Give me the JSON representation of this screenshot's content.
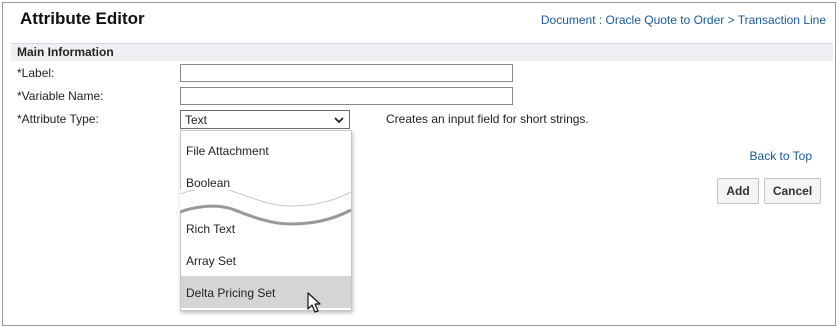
{
  "header": {
    "title": "Attribute Editor",
    "breadcrumb": "Document : Oracle Quote to Order > Transaction Line"
  },
  "section": {
    "title": "Main Information"
  },
  "form": {
    "label_field": {
      "label": "*Label:",
      "value": ""
    },
    "variable_name_field": {
      "label": "*Variable Name:",
      "value": ""
    },
    "attribute_type": {
      "label": "*Attribute Type:",
      "selected": "Text",
      "hint": "Creates an input field for short strings."
    }
  },
  "dropdown": {
    "options_top": [
      "File Attachment",
      "Boolean"
    ],
    "options_bottom": [
      "Rich Text",
      "Array Set",
      "Delta Pricing Set"
    ],
    "highlighted": "Delta Pricing Set"
  },
  "links": {
    "back_to_top": "Back to Top"
  },
  "buttons": {
    "add": "Add",
    "cancel": "Cancel"
  },
  "icons": {
    "select_arrow": "chevron-down-icon",
    "pointer": "mouse-cursor-icon"
  },
  "colors": {
    "link": "#1a5a96",
    "section_bg": "#eef0f3",
    "highlight": "#d5d5d5"
  }
}
